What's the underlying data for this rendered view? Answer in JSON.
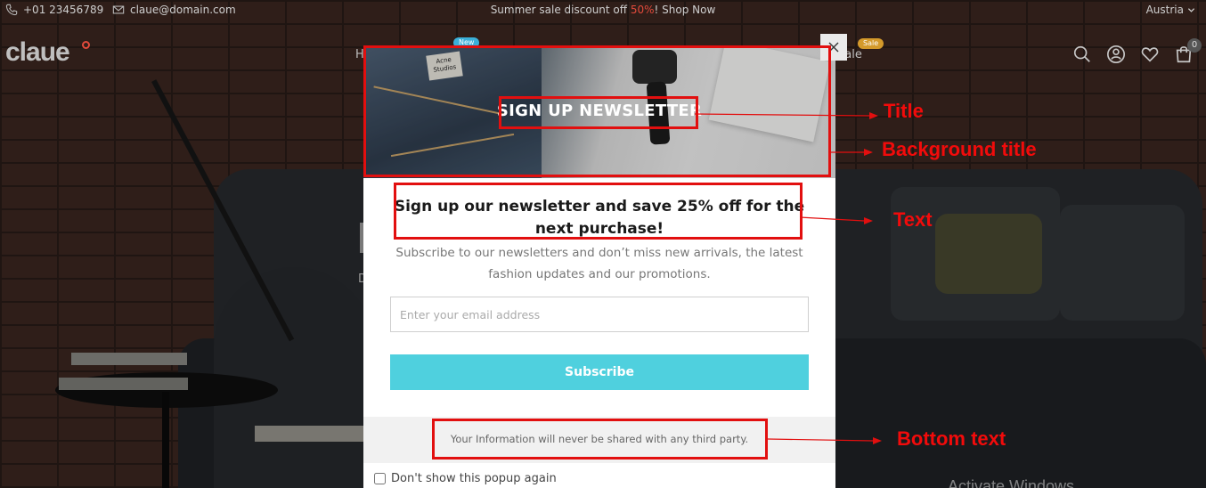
{
  "topbar": {
    "phone": "+01 23456789",
    "email": "claue@domain.com",
    "promo_prefix": "Summer sale discount off ",
    "promo_pct": "50%",
    "promo_suffix": "! Shop Now",
    "locale": "Austria"
  },
  "header": {
    "logo": "claue",
    "nav_left_peek": "H",
    "nav_right_peek": "Sale",
    "badge_new": "New",
    "badge_sale": "Sale",
    "cart_count": "0"
  },
  "hero": {
    "peek_letter": "D"
  },
  "popup": {
    "title": "SIGN UP NEWSLETTER",
    "jeans_tag": "Acne Studios",
    "heading": "Sign up our newsletter and save 25% off for the next purchase!",
    "text": "Subscribe to our newsletters and don’t miss new arrivals, the latest fashion updates and our promotions.",
    "email_placeholder": "Enter your email address",
    "subscribe_label": "Subscribe",
    "bottom_text": "Your Information will never be shared with any third party.",
    "dont_show_label": "Don't show this popup again",
    "close_symbol": "×"
  },
  "annotations": {
    "title": "Title",
    "background_title": "Background title",
    "text": "Text",
    "bottom_text": "Bottom text"
  },
  "os_watermark": "Activate Windows",
  "colors": {
    "accent": "#4fd0de",
    "annotation": "#e20f0f",
    "promo_highlight": "#e24a3b"
  }
}
